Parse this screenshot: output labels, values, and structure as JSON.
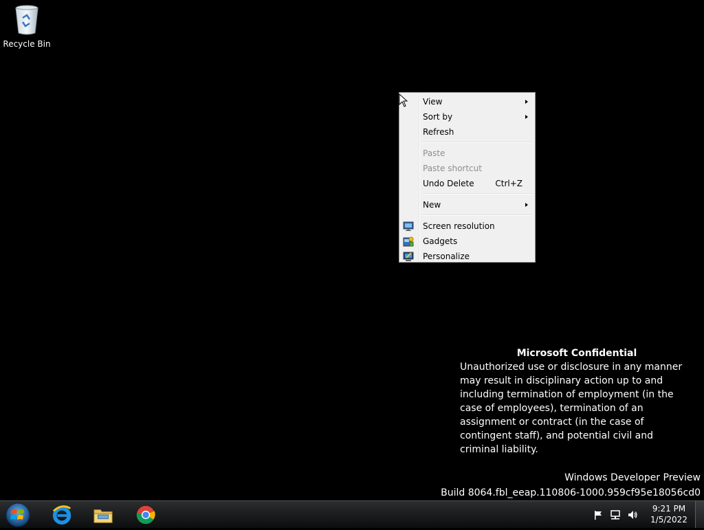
{
  "desktop": {
    "icons": [
      {
        "label": "Recycle Bin",
        "icon": "recycle-bin-icon"
      }
    ]
  },
  "context_menu": {
    "items": [
      {
        "label": "View",
        "submenu": true
      },
      {
        "label": "Sort by",
        "submenu": true
      },
      {
        "label": "Refresh"
      },
      {
        "label": "Paste",
        "disabled": true
      },
      {
        "label": "Paste shortcut",
        "disabled": true
      },
      {
        "label": "Undo Delete",
        "shortcut": "Ctrl+Z"
      },
      {
        "label": "New",
        "submenu": true
      },
      {
        "label": "Screen resolution",
        "icon": "screen-resolution-icon"
      },
      {
        "label": "Gadgets",
        "icon": "gadgets-icon"
      },
      {
        "label": "Personalize",
        "icon": "personalize-icon"
      }
    ]
  },
  "notice": {
    "title": "Microsoft Confidential",
    "body": "Unauthorized use or disclosure in any manner may result in disciplinary action up to and including termination of employment (in the case of employees), termination of an assignment or contract (in the case of contingent staff), and potential civil and criminal liability."
  },
  "watermark": {
    "line1": "Windows Developer Preview",
    "line2": "Build 8064.fbl_eeap.110806-1000.959cf95e18056cd0"
  },
  "taskbar": {
    "apps": [
      "internet-explorer-icon",
      "file-explorer-icon",
      "chrome-icon"
    ],
    "tray": [
      "action-center-flag-icon",
      "network-icon",
      "volume-icon"
    ],
    "clock": {
      "time": "9:21 PM",
      "date": "1/5/2022"
    }
  },
  "colors": {
    "desktop_background": "#000000",
    "menu_background": "#f0f0f0",
    "disabled_text": "#8d8d8d"
  }
}
